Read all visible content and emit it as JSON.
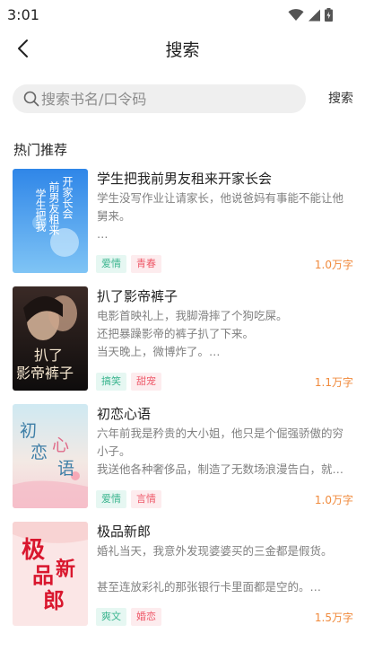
{
  "status_bar": {
    "time": "3:01",
    "icons": [
      "wifi-icon",
      "signal-icon",
      "battery-icon"
    ]
  },
  "nav": {
    "title": "搜索",
    "back_icon": "chevron-left-icon"
  },
  "search": {
    "placeholder": "搜索书名/口令码",
    "value": "",
    "button_label": "搜索"
  },
  "section": {
    "title": "热门推荐"
  },
  "books": [
    {
      "title": "学生把我前男友租来开家长会",
      "desc_lines": [
        "学生没写作业让请家长，他说爸妈有事能不能让他",
        "舅来。",
        "…"
      ],
      "tags": [
        {
          "label": "爱情",
          "style": "green"
        },
        {
          "label": "青春",
          "style": "red"
        }
      ],
      "word_count": "1.0万字",
      "cover_text": [
        "开家长会",
        "前男友租来",
        "学生把我"
      ]
    },
    {
      "title": "扒了影帝裤子",
      "desc_lines": [
        "电影首映礼上，我脚滑摔了个狗吃屎。",
        "还把暴躁影帝的裤子扒了下来。",
        "当天晚上，微博炸了。…"
      ],
      "tags": [
        {
          "label": "搞笑",
          "style": "green"
        },
        {
          "label": "甜宠",
          "style": "red"
        }
      ],
      "word_count": "1.1万字",
      "cover_text": [
        "扒了",
        "影帝裤子"
      ]
    },
    {
      "title": "初恋心语",
      "desc_lines": [
        "六年前我是矜贵的大小姐，他只是个倔强骄傲的穷",
        "小子。",
        "我送他各种奢侈品，制造了无数场浪漫告白，就…"
      ],
      "tags": [
        {
          "label": "爱情",
          "style": "green"
        },
        {
          "label": "言情",
          "style": "red"
        }
      ],
      "word_count": "1.0万字",
      "cover_text": [
        "初",
        "恋",
        "心",
        "语"
      ]
    },
    {
      "title": "极品新郎",
      "desc_lines": [
        "婚礼当天，我意外发现婆婆买的三金都是假货。",
        "",
        "甚至连放彩礼的那张银行卡里面都是空的。…"
      ],
      "tags": [
        {
          "label": "爽文",
          "style": "green"
        },
        {
          "label": "婚恋",
          "style": "red"
        }
      ],
      "word_count": "1.5万字",
      "cover_text": [
        "极",
        "品",
        "新",
        "郎"
      ]
    }
  ]
}
